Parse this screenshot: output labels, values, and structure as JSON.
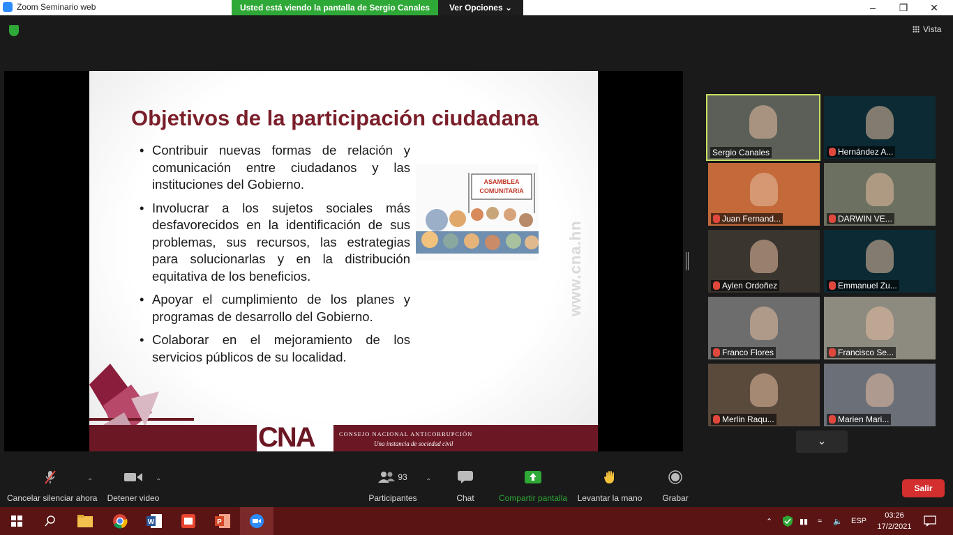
{
  "window": {
    "title": "Zoom Seminario web"
  },
  "share_banner": {
    "viewing": "Usted está viendo la pantalla de Sergio Canales",
    "options": "Ver Opciones"
  },
  "header": {
    "view_label": "Vista"
  },
  "slide": {
    "title": "Objetivos de la participación ciudadana",
    "bullets": [
      "Contribuir nuevas formas de relación y comunicación entre ciudadanos y las instituciones del Gobierno.",
      "Involucrar a los sujetos sociales más desfavorecidos en la identificación de sus problemas, sus recursos, las estrategias para solucionarlas y en la distribución equitativa de los beneficios.",
      "Apoyar el cumplimiento de los planes y programas de desarrollo del Gobierno.",
      "Colaborar en el mejoramiento de los servicios públicos de su localidad."
    ],
    "image_banner": "ASAMBLEA COMUNITARIA",
    "watermark": "www.cna.hn",
    "logo": "CNA",
    "org_name": "CONSEJO NACIONAL ANTICORRUPCIÓN",
    "org_tagline": "Una instancia de sociedad civil"
  },
  "participants_panel": [
    {
      "name": "Sergio Canales",
      "muted": false,
      "active": true,
      "bg": "#5b5f57"
    },
    {
      "name": "Hernández A...",
      "muted": true,
      "active": false,
      "bg": "#0c2a33"
    },
    {
      "name": "Juan Fernand...",
      "muted": true,
      "active": false,
      "bg": "#c46a3a"
    },
    {
      "name": "DARWIN VE...",
      "muted": true,
      "active": false,
      "bg": "#6c7060"
    },
    {
      "name": "Aylen Ordoñez",
      "muted": true,
      "active": false,
      "bg": "#3b3530"
    },
    {
      "name": "Emmanuel Zu...",
      "muted": true,
      "active": false,
      "bg": "#0c2a33"
    },
    {
      "name": "Franco Flores",
      "muted": true,
      "active": false,
      "bg": "#6d6d6d"
    },
    {
      "name": "Francisco Se...",
      "muted": true,
      "active": false,
      "bg": "#8d8a80"
    },
    {
      "name": "Merlin  Raqu...",
      "muted": true,
      "active": false,
      "bg": "#5a4a3c"
    },
    {
      "name": "Marien Mari...",
      "muted": true,
      "active": false,
      "bg": "#6b6f78"
    }
  ],
  "toolbar": {
    "unmute": "Cancelar silenciar ahora",
    "stop_video": "Detener video",
    "participants": "Participantes",
    "participants_count": "93",
    "chat": "Chat",
    "share": "Compartir pantalla",
    "raise_hand": "Levantar la mano",
    "record": "Grabar",
    "leave": "Salir"
  },
  "taskbar": {
    "language": "ESP",
    "time": "03:26",
    "date": "17/2/2021"
  },
  "colors": {
    "share_green": "#2ea836",
    "slide_title": "#7a1f2a",
    "cna_maroon": "#6b1824",
    "leave_red": "#d32f2f",
    "taskbar": "#5a1414"
  }
}
